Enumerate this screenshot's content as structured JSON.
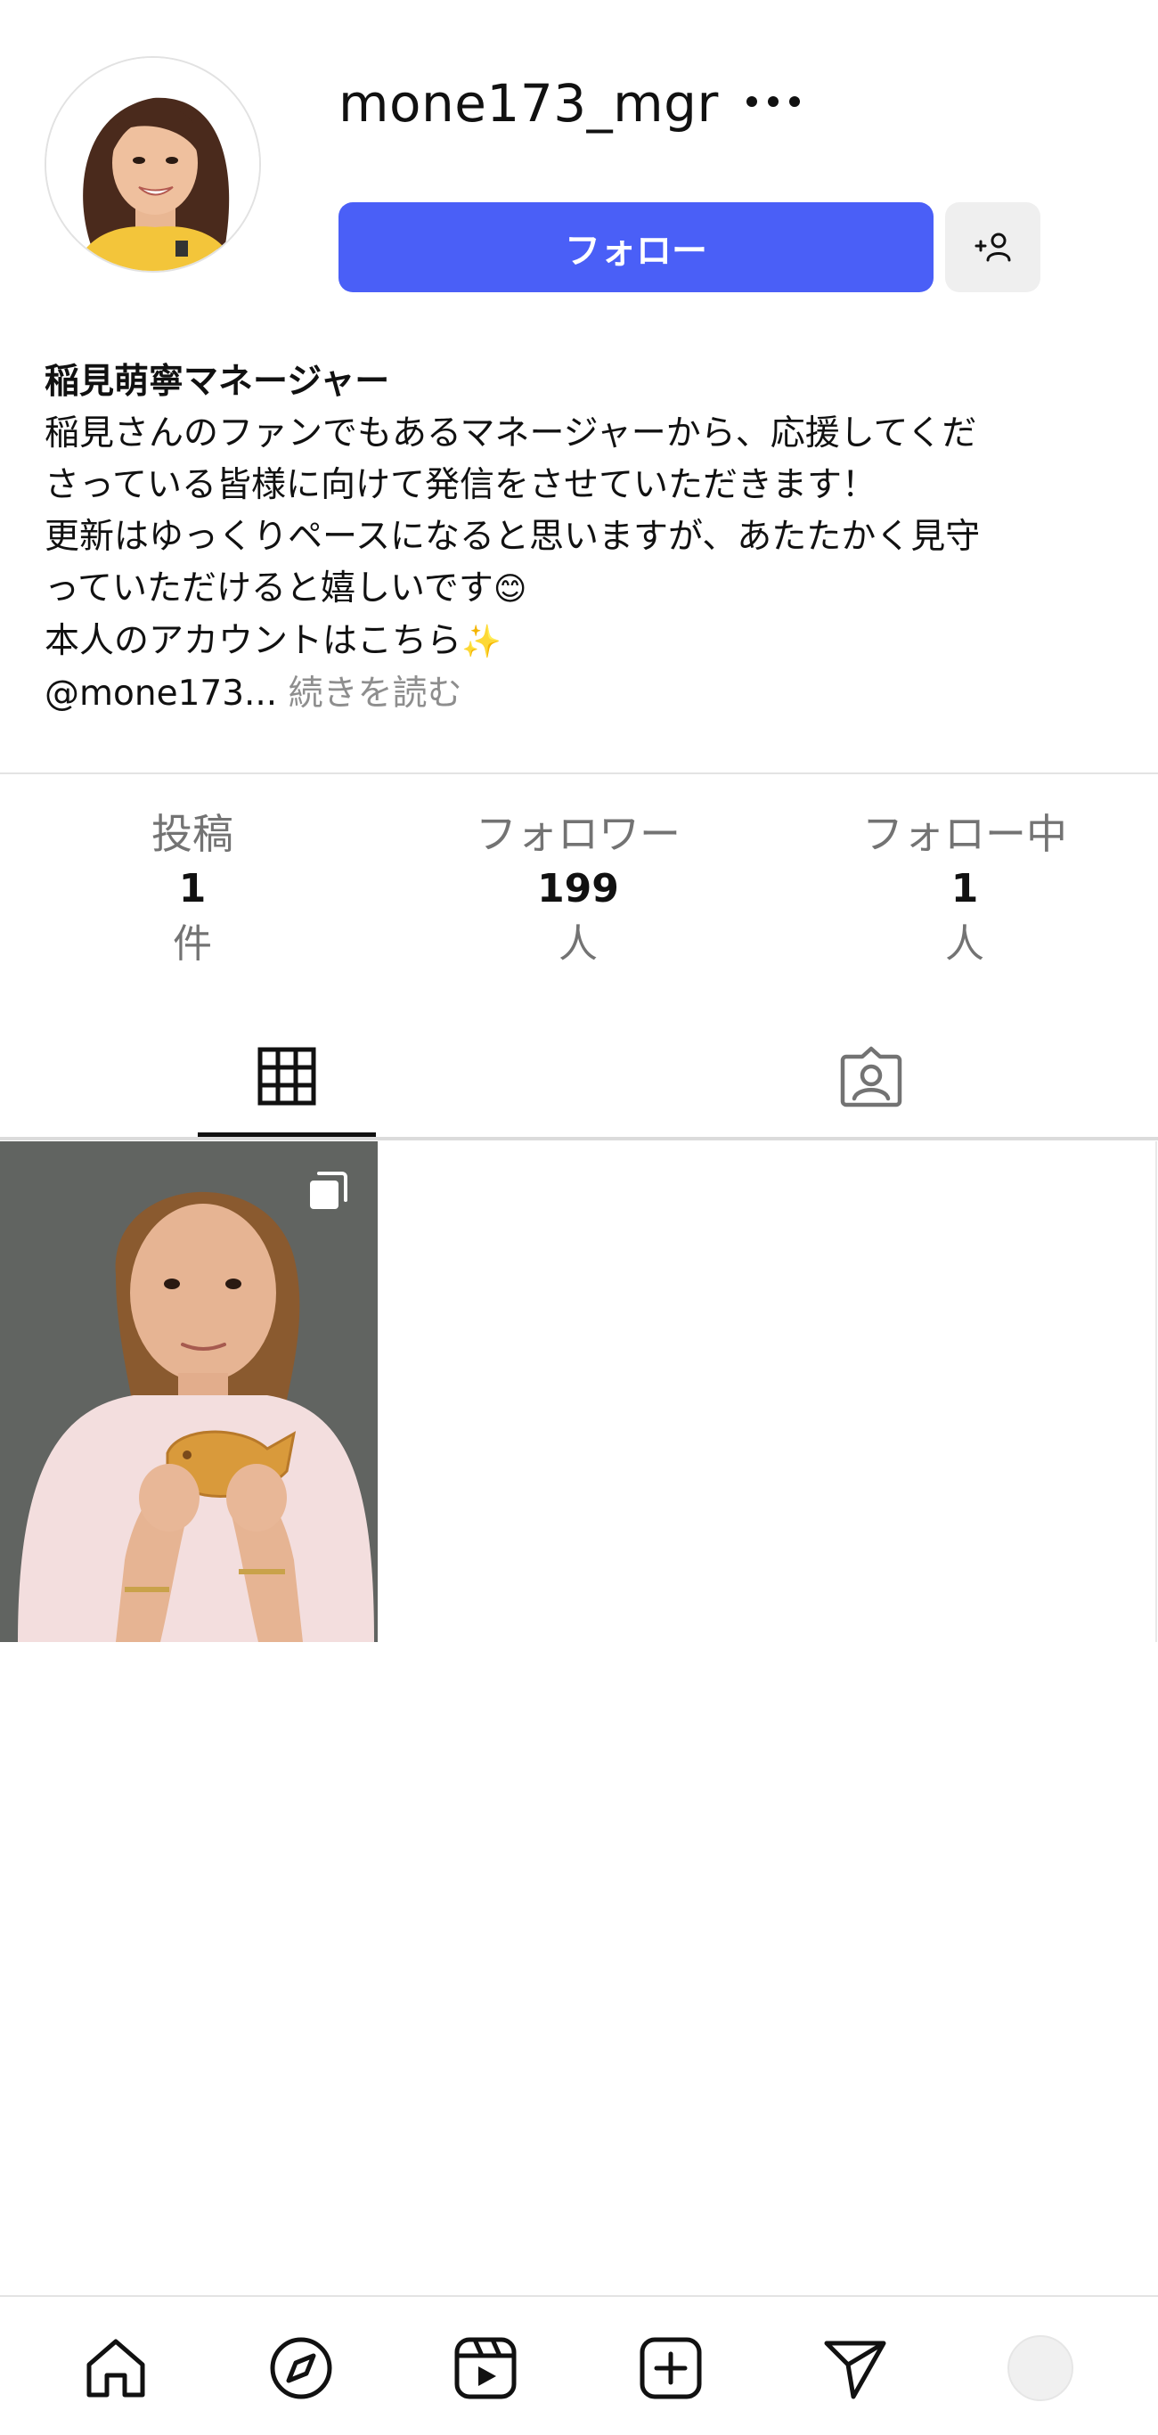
{
  "profile": {
    "username": "mone173_mgr",
    "follow_label": "フォロー",
    "avatar_alt": "profile photo"
  },
  "bio": {
    "name": "稲見萌寧マネージャー",
    "lines": [
      "稲見さんのファンでもあるマネージャーから、応援してくだ",
      "さっている皆様に向けて発信をさせていただきます！",
      "更新はゆっくりペースになると思いますが、あたたかく見守",
      "っていただけると嬉しいです",
      "本人のアカウントはこちら"
    ],
    "emoji_smile": "😊",
    "emoji_sparkles": "✨",
    "handle": "@mone173...",
    "read_more": "続きを読む"
  },
  "stats": [
    {
      "label": "投稿",
      "value": "1",
      "unit": "件"
    },
    {
      "label": "フォロワー",
      "value": "199",
      "unit": "人"
    },
    {
      "label": "フォロー中",
      "value": "1",
      "unit": "人"
    }
  ],
  "tabs": {
    "active": "grid",
    "items": [
      "grid-icon",
      "tagged-icon"
    ]
  },
  "posts": [
    {
      "type": "carousel",
      "icon": "multiple-images-icon"
    }
  ],
  "nav": {
    "items": [
      "home-icon",
      "explore-icon",
      "reels-icon",
      "create-icon",
      "direct-icon",
      "profile-avatar"
    ]
  },
  "colors": {
    "follow_button": "#4a5ff7",
    "secondary_button": "#efefef",
    "muted_text": "#737373",
    "read_more": "#8e8e8e"
  }
}
